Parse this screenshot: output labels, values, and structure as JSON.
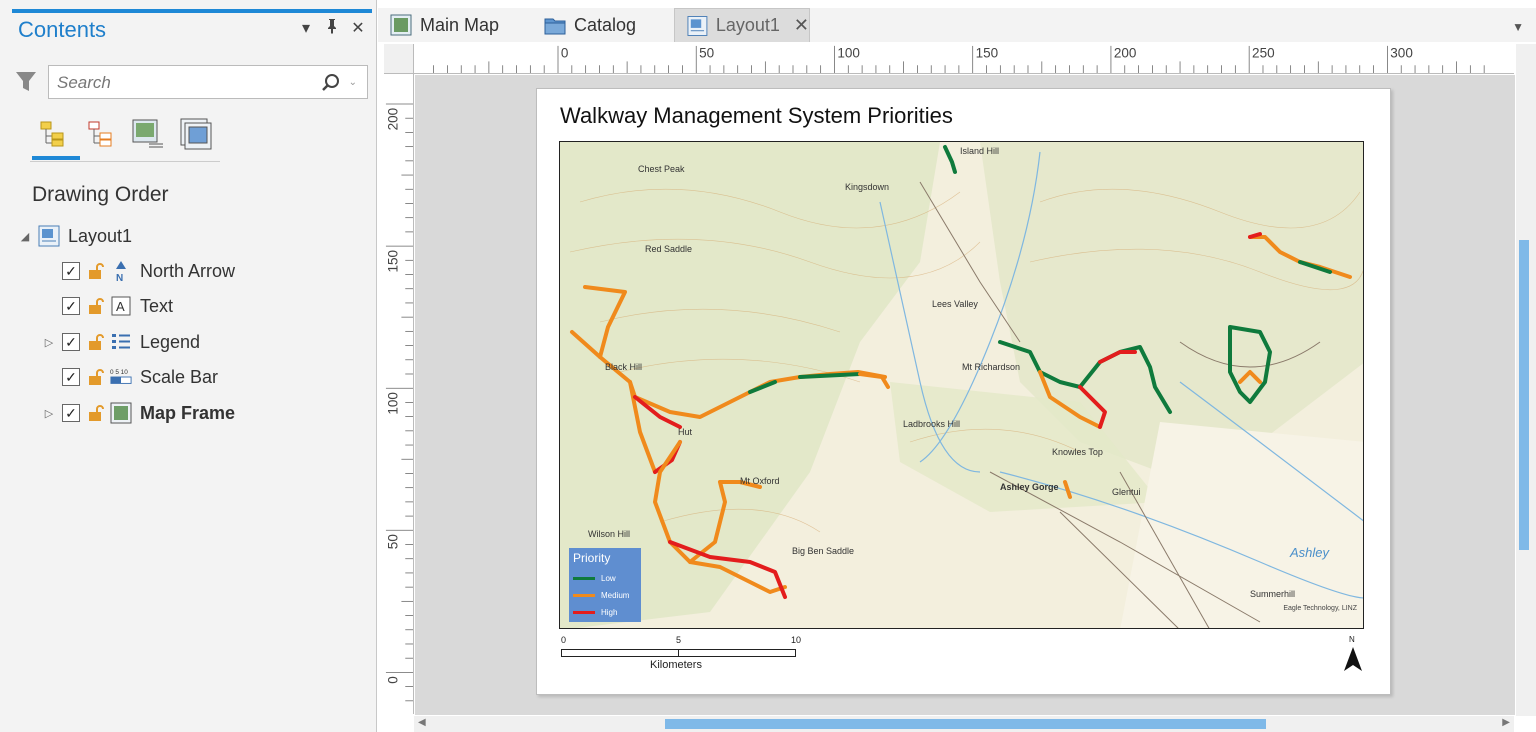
{
  "contents": {
    "title": "Contents",
    "search_placeholder": "Search",
    "section_label": "Drawing Order",
    "tree": [
      {
        "label": "Layout1",
        "icon": "layout-icon"
      },
      {
        "label": "North Arrow",
        "icon": "north-arrow-icon"
      },
      {
        "label": "Text",
        "icon": "text-icon"
      },
      {
        "label": "Legend",
        "icon": "legend-icon"
      },
      {
        "label": "Scale Bar",
        "icon": "scale-bar-icon"
      },
      {
        "label": "Map Frame",
        "icon": "map-frame-icon"
      }
    ]
  },
  "tabs": [
    {
      "label": "Main Map",
      "icon": "map-icon"
    },
    {
      "label": "Catalog",
      "icon": "catalog-icon"
    },
    {
      "label": "Layout1",
      "icon": "layout-icon",
      "active": true
    }
  ],
  "rulers": {
    "horizontal": [
      "0",
      "50",
      "100",
      "150",
      "200",
      "250",
      "300"
    ],
    "vertical": [
      "200",
      "150",
      "100",
      "50",
      "0"
    ]
  },
  "layout": {
    "title": "Walkway Management System Priorities",
    "legend": {
      "title": "Priority",
      "items": [
        {
          "label": "Low",
          "color": "#0f7a3c"
        },
        {
          "label": "Medium",
          "color": "#f08a1c"
        },
        {
          "label": "High",
          "color": "#e31d1d"
        }
      ]
    },
    "scalebar": {
      "ticks": [
        "0",
        "5",
        "10"
      ],
      "unit": "Kilometers"
    },
    "north_label": "N",
    "credit": "Eagle Technology, LINZ",
    "place_labels": [
      "Island Hill",
      "Chest Peak",
      "Kingsdown",
      "Lees Valley",
      "Mt Richardson",
      "Ladbrooks Hill",
      "Mt Oxford",
      "Big Ben Saddle",
      "Ashley Gorge",
      "Glentui",
      "Knowles Top",
      "Summerhill",
      "Wilson Hill",
      "Black Hill",
      "Red Saddle",
      "Ashley",
      "Hut"
    ]
  },
  "colors": {
    "accent": "#1e88d6",
    "legend_bg": "#5f8ed0"
  }
}
